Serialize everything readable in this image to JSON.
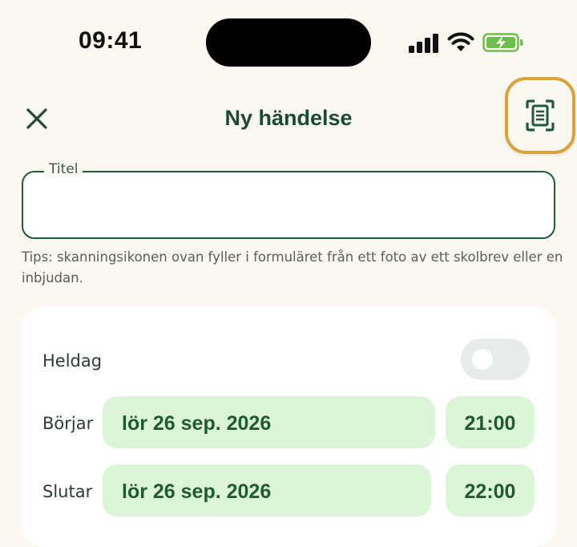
{
  "status_bar": {
    "time": "09:41"
  },
  "nav": {
    "title": "Ny händelse"
  },
  "form": {
    "title_label": "Titel",
    "title_value": "",
    "tips": "Tips: skanningsikonen ovan fyller i formuläret från ett foto av ett skolbrev eller en inbjudan."
  },
  "card": {
    "allday_label": "Heldag",
    "allday_on": false,
    "start_label": "Börjar",
    "start_date": "lör 26 sep. 2026",
    "start_time": "21:00",
    "end_label": "Slutar",
    "end_date": "lör 26 sep. 2026",
    "end_time": "22:00"
  },
  "colors": {
    "accent": "#1f5a3a",
    "highlight": "#d9a33a",
    "pill_bg": "#dcf5d9",
    "background": "#faf8f1"
  }
}
